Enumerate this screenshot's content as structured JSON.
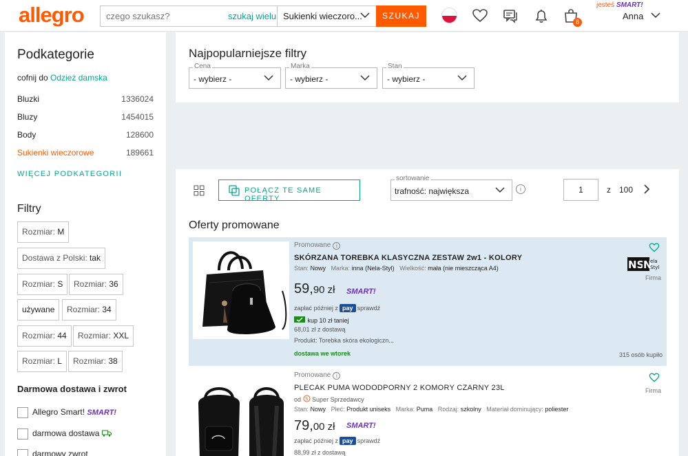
{
  "header": {
    "logo": "allegro",
    "search_placeholder": "czego szukasz?",
    "search_multi": "szukaj wielu",
    "category": "Sukienki wieczoro...",
    "search_button": "SZUKAJ",
    "cart_count": "8",
    "smart_prefix": "jesteś",
    "smart_label": "SMART!",
    "user_name": "Anna"
  },
  "sidebar": {
    "title": "Podkategorie",
    "back_prefix": "cofnij do",
    "back_link": "Odzież damska",
    "categories": [
      {
        "label": "Bluzki",
        "count": "1336024"
      },
      {
        "label": "Bluzy",
        "count": "1454015"
      },
      {
        "label": "Body",
        "count": "128600"
      },
      {
        "label": "Sukienki wieczorowe",
        "count": "189661"
      }
    ],
    "more_label": "WIĘCEJ PODKATEGORII",
    "filters_title": "Filtry",
    "chips": [
      {
        "prefix": "Rozmiar:",
        "value": "M"
      },
      {
        "prefix": "Dostawa z Polski:",
        "value": "tak"
      },
      {
        "prefix": "Rozmiar:",
        "value": "S"
      },
      {
        "prefix": "Rozmiar:",
        "value": "36"
      },
      {
        "prefix": "",
        "value": "używane"
      },
      {
        "prefix": "Rozmiar:",
        "value": "34"
      },
      {
        "prefix": "Rozmiar:",
        "value": "44"
      },
      {
        "prefix": "Rozmiar:",
        "value": "XXL"
      },
      {
        "prefix": "Rozmiar:",
        "value": "L"
      },
      {
        "prefix": "Rozmiar:",
        "value": "38"
      }
    ],
    "delivery_title": "Darmowa dostawa i zwrot",
    "checkboxes": [
      {
        "label": "Allegro Smart!",
        "badge": "SMART!"
      },
      {
        "label": "darmowa dostawa",
        "badge": ""
      },
      {
        "label": "darmowy zwrot",
        "badge": ""
      }
    ]
  },
  "filters": {
    "title": "Najpopularniejsze filtry",
    "selects": [
      {
        "legend": "Cena",
        "value": "- wybierz -"
      },
      {
        "legend": "Marka",
        "value": "- wybierz -"
      },
      {
        "legend": "Stan",
        "value": "- wybierz -"
      }
    ]
  },
  "listing": {
    "merge_button": "POŁĄCZ TE SAME OFERTY",
    "sort_legend": "sortowanie",
    "sort_value": "trafność: największa",
    "page_current": "1",
    "page_of": "z",
    "page_total": "100",
    "promo_heading": "Oferty promowane",
    "offers": [
      {
        "promo_label": "Promowane",
        "title": "SKÓRZANA TOREBKA KLASYCZNA ZESTAW 2w1 - KOLORY",
        "params": [
          {
            "k": "Stan:",
            "v": "Nowy"
          },
          {
            "k": "Marka:",
            "v": "inna (Nela-Styl)"
          },
          {
            "k": "Wielkość:",
            "v": "mała (nie mieszcząca A4)"
          }
        ],
        "price_int": "59,",
        "price_dec": "90 zł",
        "smart": "SMART!",
        "pay_prefix": "zapłać później z",
        "pay_badge": "pay",
        "pay_suffix": "sprawdź",
        "coupon": "kup 10 zł taniej",
        "with_delivery": "68,01 zł z dostawą",
        "product": "Produkt: Torebka skóra ekologiczn...",
        "delivery": "dostawa we wtorek",
        "bought": "315 osób kupiło",
        "seller_type": "Firma",
        "seller_logo": "NSNela Styl"
      },
      {
        "promo_label": "Promowane",
        "title": "PLECAK PUMA WODODPORNY 2 KOMORY CZARNY 23L",
        "seller_prefix": "od",
        "seller_name": "Super Sprzedawcy",
        "params": [
          {
            "k": "Stan:",
            "v": "Nowy"
          },
          {
            "k": "Płeć:",
            "v": "Produkt uniseks"
          },
          {
            "k": "Marka:",
            "v": "Puma"
          },
          {
            "k": "Rodzaj:",
            "v": "szkolny"
          },
          {
            "k": "Materiał dominujący:",
            "v": "poliester"
          }
        ],
        "price_int": "79,",
        "price_dec": "00 zł",
        "smart": "SMART!",
        "pay_prefix": "zapłać później z",
        "pay_badge": "pay",
        "pay_suffix": "sprawdź",
        "with_delivery": "88,99 zł z dostawą",
        "seller_type": "Firma"
      }
    ]
  },
  "colors": {
    "brand": "#ff5a00",
    "accent": "#00a790",
    "smart": "#6c2ebe",
    "highlight": "#dce8f2"
  }
}
